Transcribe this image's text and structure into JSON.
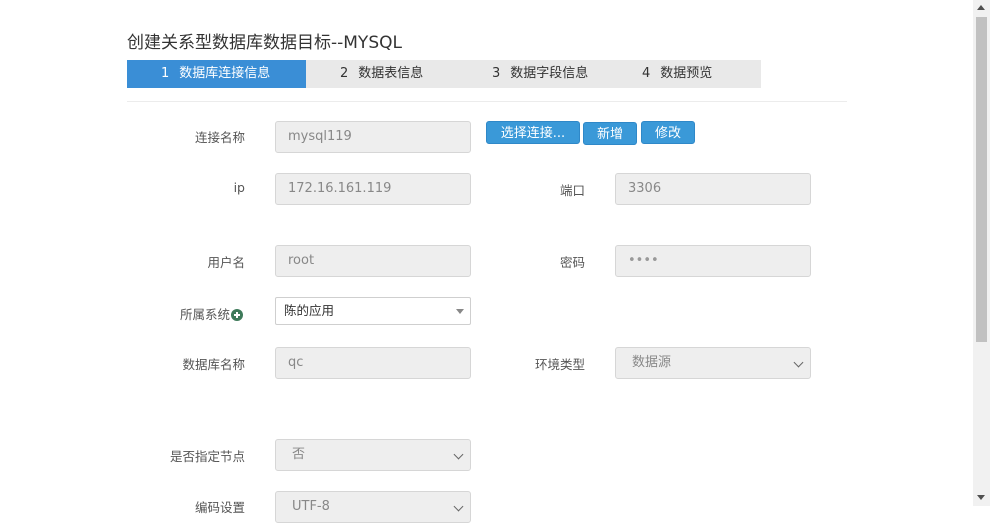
{
  "title": "创建关系型数据库数据目标--MYSQL",
  "steps": [
    {
      "num": "1",
      "label": "数据库连接信息",
      "active": true
    },
    {
      "num": "2",
      "label": "数据表信息"
    },
    {
      "num": "3",
      "label": "数据字段信息"
    },
    {
      "num": "4",
      "label": "数据预览"
    }
  ],
  "form": {
    "connection_name": {
      "label": "连接名称",
      "value": "mysql119"
    },
    "ip": {
      "label": "ip",
      "value": "172.16.161.119"
    },
    "port": {
      "label": "端口",
      "value": "3306"
    },
    "username": {
      "label": "用户名",
      "value": "root"
    },
    "password": {
      "label": "密码",
      "value": "••••"
    },
    "system": {
      "label": "所属系统",
      "value": "陈的应用"
    },
    "db_name": {
      "label": "数据库名称",
      "value": "qc"
    },
    "env_type": {
      "label": "环境类型",
      "value": "数据源"
    },
    "specify_node": {
      "label": "是否指定节点",
      "value": "否"
    },
    "encoding": {
      "label": "编码设置",
      "value": "UTF-8"
    }
  },
  "buttons": {
    "select_connection": "选择连接...",
    "add": "新增",
    "edit": "修改"
  },
  "icons": {
    "add_system": "plus-circle-icon"
  }
}
